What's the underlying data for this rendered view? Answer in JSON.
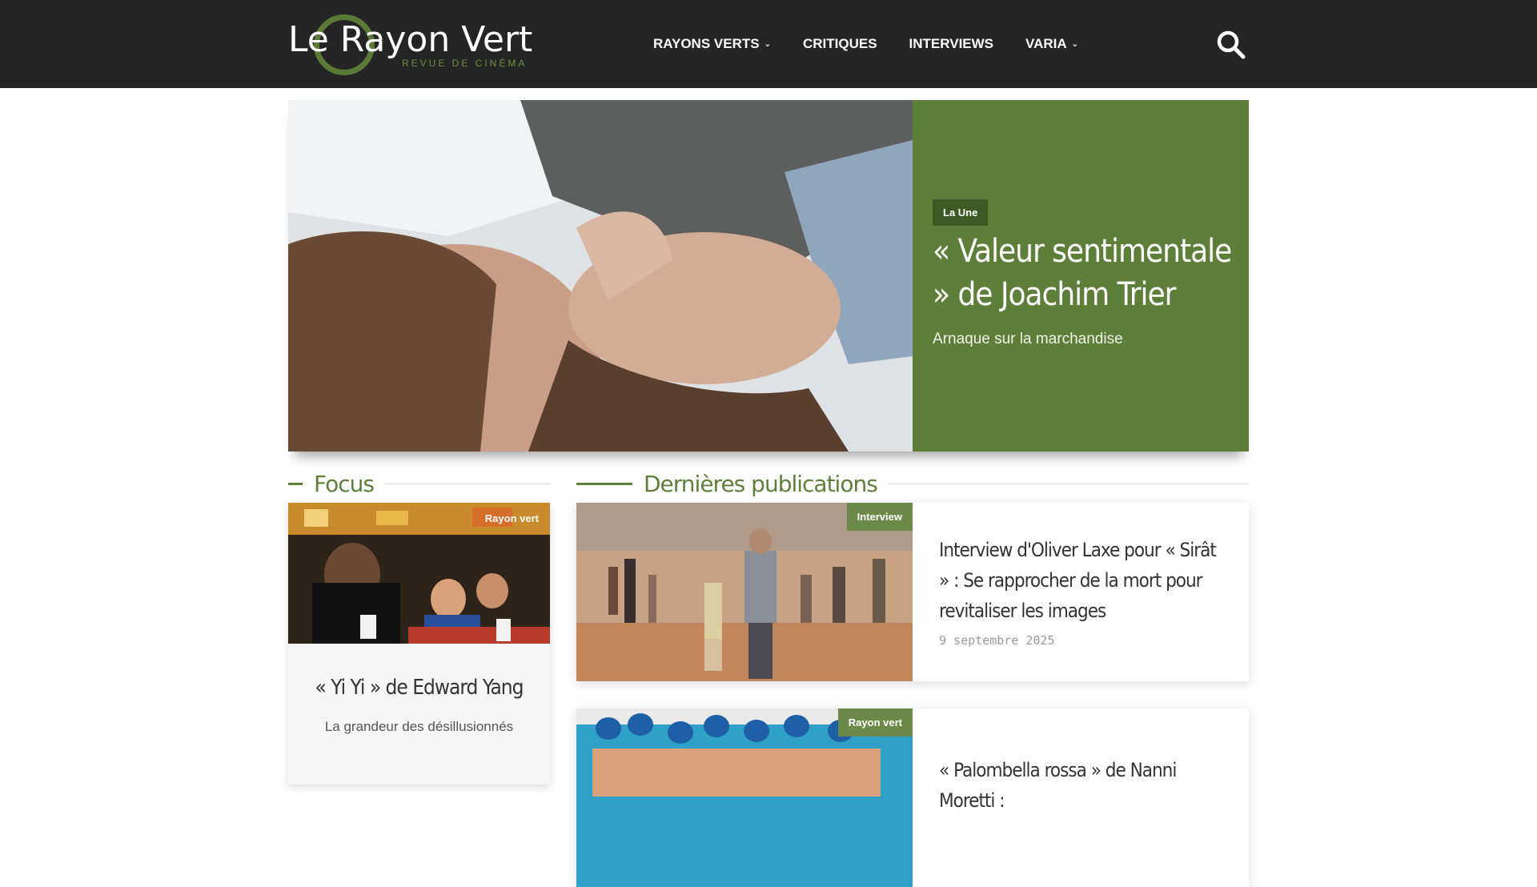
{
  "header": {
    "logo_text": "Le Rayon Vert",
    "logo_tagline": "REVUE DE CINÉMA",
    "nav": [
      {
        "label": "RAYONS VERTS",
        "has_dropdown": true
      },
      {
        "label": "CRITIQUES",
        "has_dropdown": false
      },
      {
        "label": "INTERVIEWS",
        "has_dropdown": false
      },
      {
        "label": "VARIA",
        "has_dropdown": true
      }
    ],
    "search_icon": "search-icon"
  },
  "hero": {
    "badge": "La Une",
    "title": "« Valeur sentimentale » de Joachim Trier",
    "subtitle": "Arnaque sur la marchandise"
  },
  "focus": {
    "heading": "Focus",
    "tag": "Rayon vert",
    "title": "« Yi Yi » de Edward Yang",
    "subtitle": "La grandeur des désillusionnés"
  },
  "latest": {
    "heading": "Dernières publications",
    "articles": [
      {
        "tag": "Interview",
        "title": "Interview d'Oliver Laxe pour « Sirât » : Se rapprocher de la mort pour revitaliser les images",
        "date": "9 septembre 2025"
      },
      {
        "tag": "Rayon vert",
        "title": "« Palombella rossa » de Nanni Moretti :"
      }
    ]
  },
  "colors": {
    "header_bg": "#252525",
    "accent_green": "#5e7f3a",
    "tag_green": "#6b8a4a"
  }
}
